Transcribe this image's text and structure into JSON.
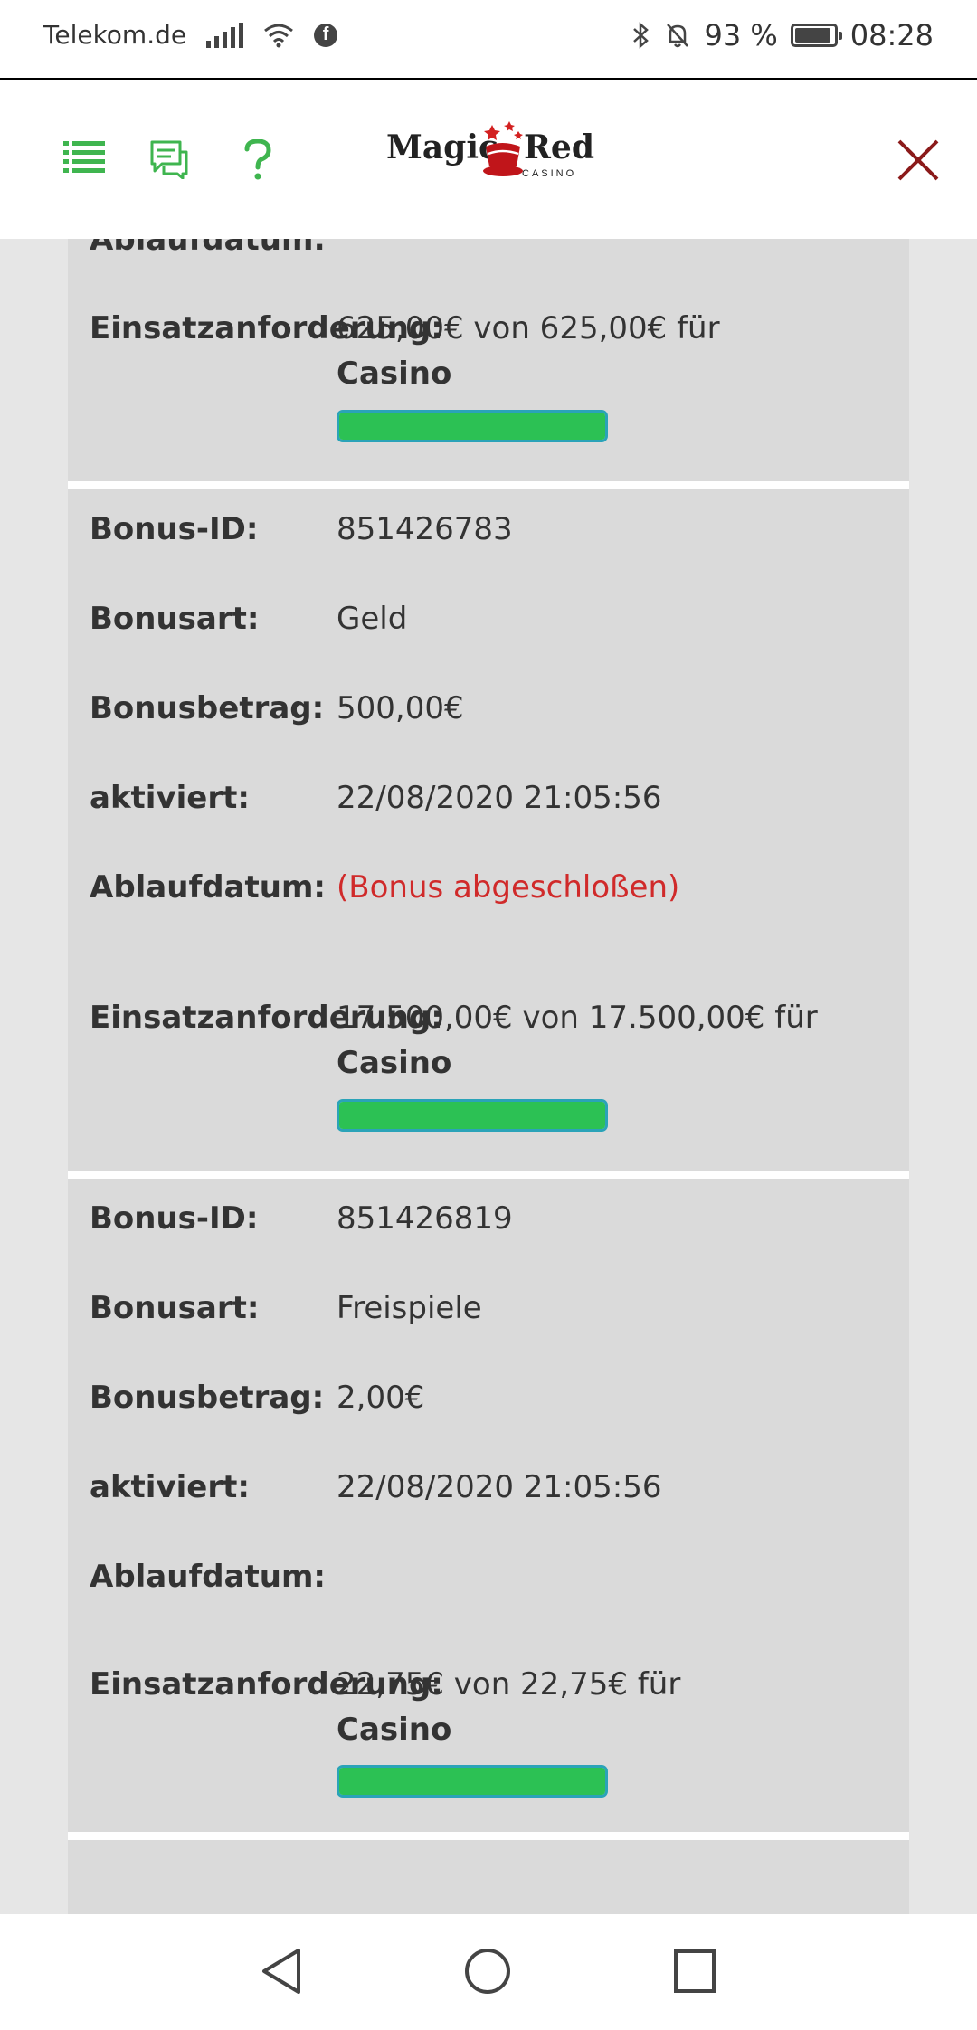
{
  "status_bar": {
    "carrier": "Telekom.de",
    "battery": "93 %",
    "battery_level": 0.93,
    "time": "08:28"
  },
  "header": {
    "logo_primary": "Magic",
    "logo_secondary": "Red",
    "logo_sub": "CASINO",
    "icons": [
      "list-icon",
      "chat-icon",
      "help-icon",
      "close-icon"
    ],
    "accent_color": "#3fb54f",
    "close_color": "#8b1a1a"
  },
  "bonuses": [
    {
      "partial": true,
      "expiry_label": "Ablaufdatum:",
      "wager_label": "Einsatzanforderung:",
      "wager_value": "625,00€ von 625,00€ für",
      "wager_game": "Casino",
      "progress": 1.0
    },
    {
      "id_label": "Bonus-ID:",
      "id_value": "851426783",
      "type_label": "Bonusart:",
      "type_value": "Geld",
      "amount_label": "Bonusbetrag:",
      "amount_value": "500,00€",
      "activated_label": "aktiviert:",
      "activated_value": "22/08/2020 21:05:56",
      "expiry_label": "Ablaufdatum:",
      "expiry_value": "(Bonus abgeschloßen)",
      "wager_label": "Einsatzanforderung:",
      "wager_value": "17.500,00€ von 17.500,00€ für",
      "wager_game": "Casino",
      "progress": 1.0
    },
    {
      "id_label": "Bonus-ID:",
      "id_value": "851426819",
      "type_label": "Bonusart:",
      "type_value": "Freispiele",
      "amount_label": "Bonusbetrag:",
      "amount_value": "2,00€",
      "activated_label": "aktiviert:",
      "activated_value": "22/08/2020 21:05:56",
      "expiry_label": "Ablaufdatum:",
      "expiry_value": "",
      "wager_label": "Einsatzanforderung:",
      "wager_value": "22,75€ von 22,75€ für",
      "wager_game": "Casino",
      "progress": 1.0
    }
  ],
  "colors": {
    "expired_text": "#d02a2a",
    "progress_fill": "#2cc154",
    "progress_border": "#2aa3b8"
  },
  "nav": [
    "back-icon",
    "home-icon",
    "recents-icon"
  ]
}
